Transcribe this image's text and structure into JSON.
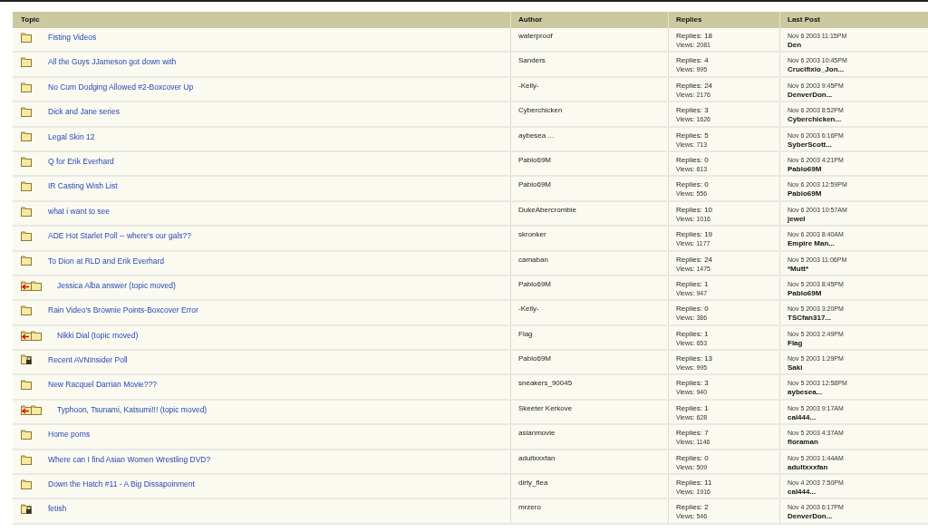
{
  "table": {
    "columns": [
      "Topic",
      "Author",
      "Replies",
      "Last Post"
    ],
    "rows": [
      {
        "kind": "folder",
        "topic": "Fisting Videos",
        "author": "waterproof",
        "replies": "Replies: 18",
        "views": "Views: 2081",
        "date": "Nov 6 2003 11:15PM",
        "last_by": "Den"
      },
      {
        "kind": "folder",
        "topic": "All the Guys JJameson got down with",
        "author": "Sanders",
        "replies": "Replies: 4",
        "views": "Views: 995",
        "date": "Nov 6 2003 10:45PM",
        "last_by": "Crucifixio_Jon..."
      },
      {
        "kind": "folder",
        "topic": "No Cum Dodging Allowed #2-Boxcover Up",
        "author": "-Kelly-",
        "replies": "Replies: 24",
        "views": "Views: 2176",
        "date": "Nov 6 2003 9:45PM",
        "last_by": "DenverDon..."
      },
      {
        "kind": "folder",
        "topic": "Dick and Jane series",
        "author": "Cyberchicken",
        "replies": "Replies: 3",
        "views": "Views: 1626",
        "date": "Nov 6 2003 8:52PM",
        "last_by": "Cyberchicken..."
      },
      {
        "kind": "folder",
        "topic": "Legal Skin 12",
        "author": "aybesea ...",
        "replies": "Replies: 5",
        "views": "Views: 713",
        "date": "Nov 6 2003 6:16PM",
        "last_by": "SyberScott..."
      },
      {
        "kind": "folder",
        "topic": "Q for Erik Everhard",
        "author": "Pablo69M",
        "replies": "Replies: 0",
        "views": "Views: 613",
        "date": "Nov 6 2003 4:21PM",
        "last_by": "Pablo69M"
      },
      {
        "kind": "folder",
        "topic": "IR Casting Wish List",
        "author": "Pablo69M",
        "replies": "Replies: 0",
        "views": "Views: 556",
        "date": "Nov 6 2003 12:59PM",
        "last_by": "Pablo69M"
      },
      {
        "kind": "folder",
        "topic": "what i want to see",
        "author": "DukeAbercrombie",
        "replies": "Replies: 10",
        "views": "Views: 1016",
        "date": "Nov 6 2003 10:57AM",
        "last_by": "jewel"
      },
      {
        "kind": "folder",
        "topic": "ADE Hot Starlet Poll -- where's our gals??",
        "author": "skronker",
        "replies": "Replies: 19",
        "views": "Views: 1177",
        "date": "Nov 6 2003 8:40AM",
        "last_by": "Empire Man..."
      },
      {
        "kind": "folder",
        "topic": "To Dion at RLD and Erik Everhard",
        "author": "camaban",
        "replies": "Replies: 24",
        "views": "Views: 1475",
        "date": "Nov 5 2003 11:06PM",
        "last_by": "*Mutt*"
      },
      {
        "kind": "moved",
        "topic": "Jessica Alba answer (topic moved)",
        "author": "Pablo69M",
        "replies": "Replies: 1",
        "views": "Views: 947",
        "date": "Nov 5 2003 8:45PM",
        "last_by": "Pablo69M"
      },
      {
        "kind": "folder",
        "topic": "Rain Video's Brownie Points-Boxcover Error",
        "author": "-Kelly-",
        "replies": "Replies: 0",
        "views": "Views: 386",
        "date": "Nov 5 2003 3:20PM",
        "last_by": "TSCfan317..."
      },
      {
        "kind": "moved",
        "topic": "Nikki Dial (topic moved)",
        "author": "Flag",
        "replies": "Replies: 1",
        "views": "Views: 653",
        "date": "Nov 5 2003 2:49PM",
        "last_by": "Flag"
      },
      {
        "kind": "locked",
        "topic": "Recent AVNInsider Poll",
        "author": "Pablo69M",
        "replies": "Replies: 13",
        "views": "Views: 995",
        "date": "Nov 5 2003 1:29PM",
        "last_by": "Saki"
      },
      {
        "kind": "folder",
        "topic": "New Racquel Darrian Movie???",
        "author": "sneakers_90045",
        "replies": "Replies: 3",
        "views": "Views: 940",
        "date": "Nov 5 2003 12:58PM",
        "last_by": "aybesea..."
      },
      {
        "kind": "moved",
        "topic": "Typhoon, Tsunami, Katsumi!!! (topic moved)",
        "author": "Skeeter Kerkove",
        "replies": "Replies: 1",
        "views": "Views: 628",
        "date": "Nov 5 2003 9:17AM",
        "last_by": "cal444..."
      },
      {
        "kind": "folder",
        "topic": "Home porns",
        "author": "asianmovie",
        "replies": "Replies: 7",
        "views": "Views: 1146",
        "date": "Nov 5 2003 4:37AM",
        "last_by": "floraman"
      },
      {
        "kind": "folder",
        "topic": "Where can I find Asian Women Wrestling DVD?",
        "author": "adultxxxfan",
        "replies": "Replies: 0",
        "views": "Views: 509",
        "date": "Nov 5 2003 1:44AM",
        "last_by": "adultxxxfan"
      },
      {
        "kind": "folder",
        "topic": "Down the Hatch #11 - A Big Dissapoinment",
        "author": "dirty_flea",
        "replies": "Replies: 11",
        "views": "Views: 1916",
        "date": "Nov 4 2003 7:50PM",
        "last_by": "cal444..."
      },
      {
        "kind": "locked",
        "topic": "fetish",
        "author": "mrzero",
        "replies": "Replies: 2",
        "views": "Views: 546",
        "date": "Nov 4 2003 6:17PM",
        "last_by": "DenverDon..."
      }
    ]
  }
}
